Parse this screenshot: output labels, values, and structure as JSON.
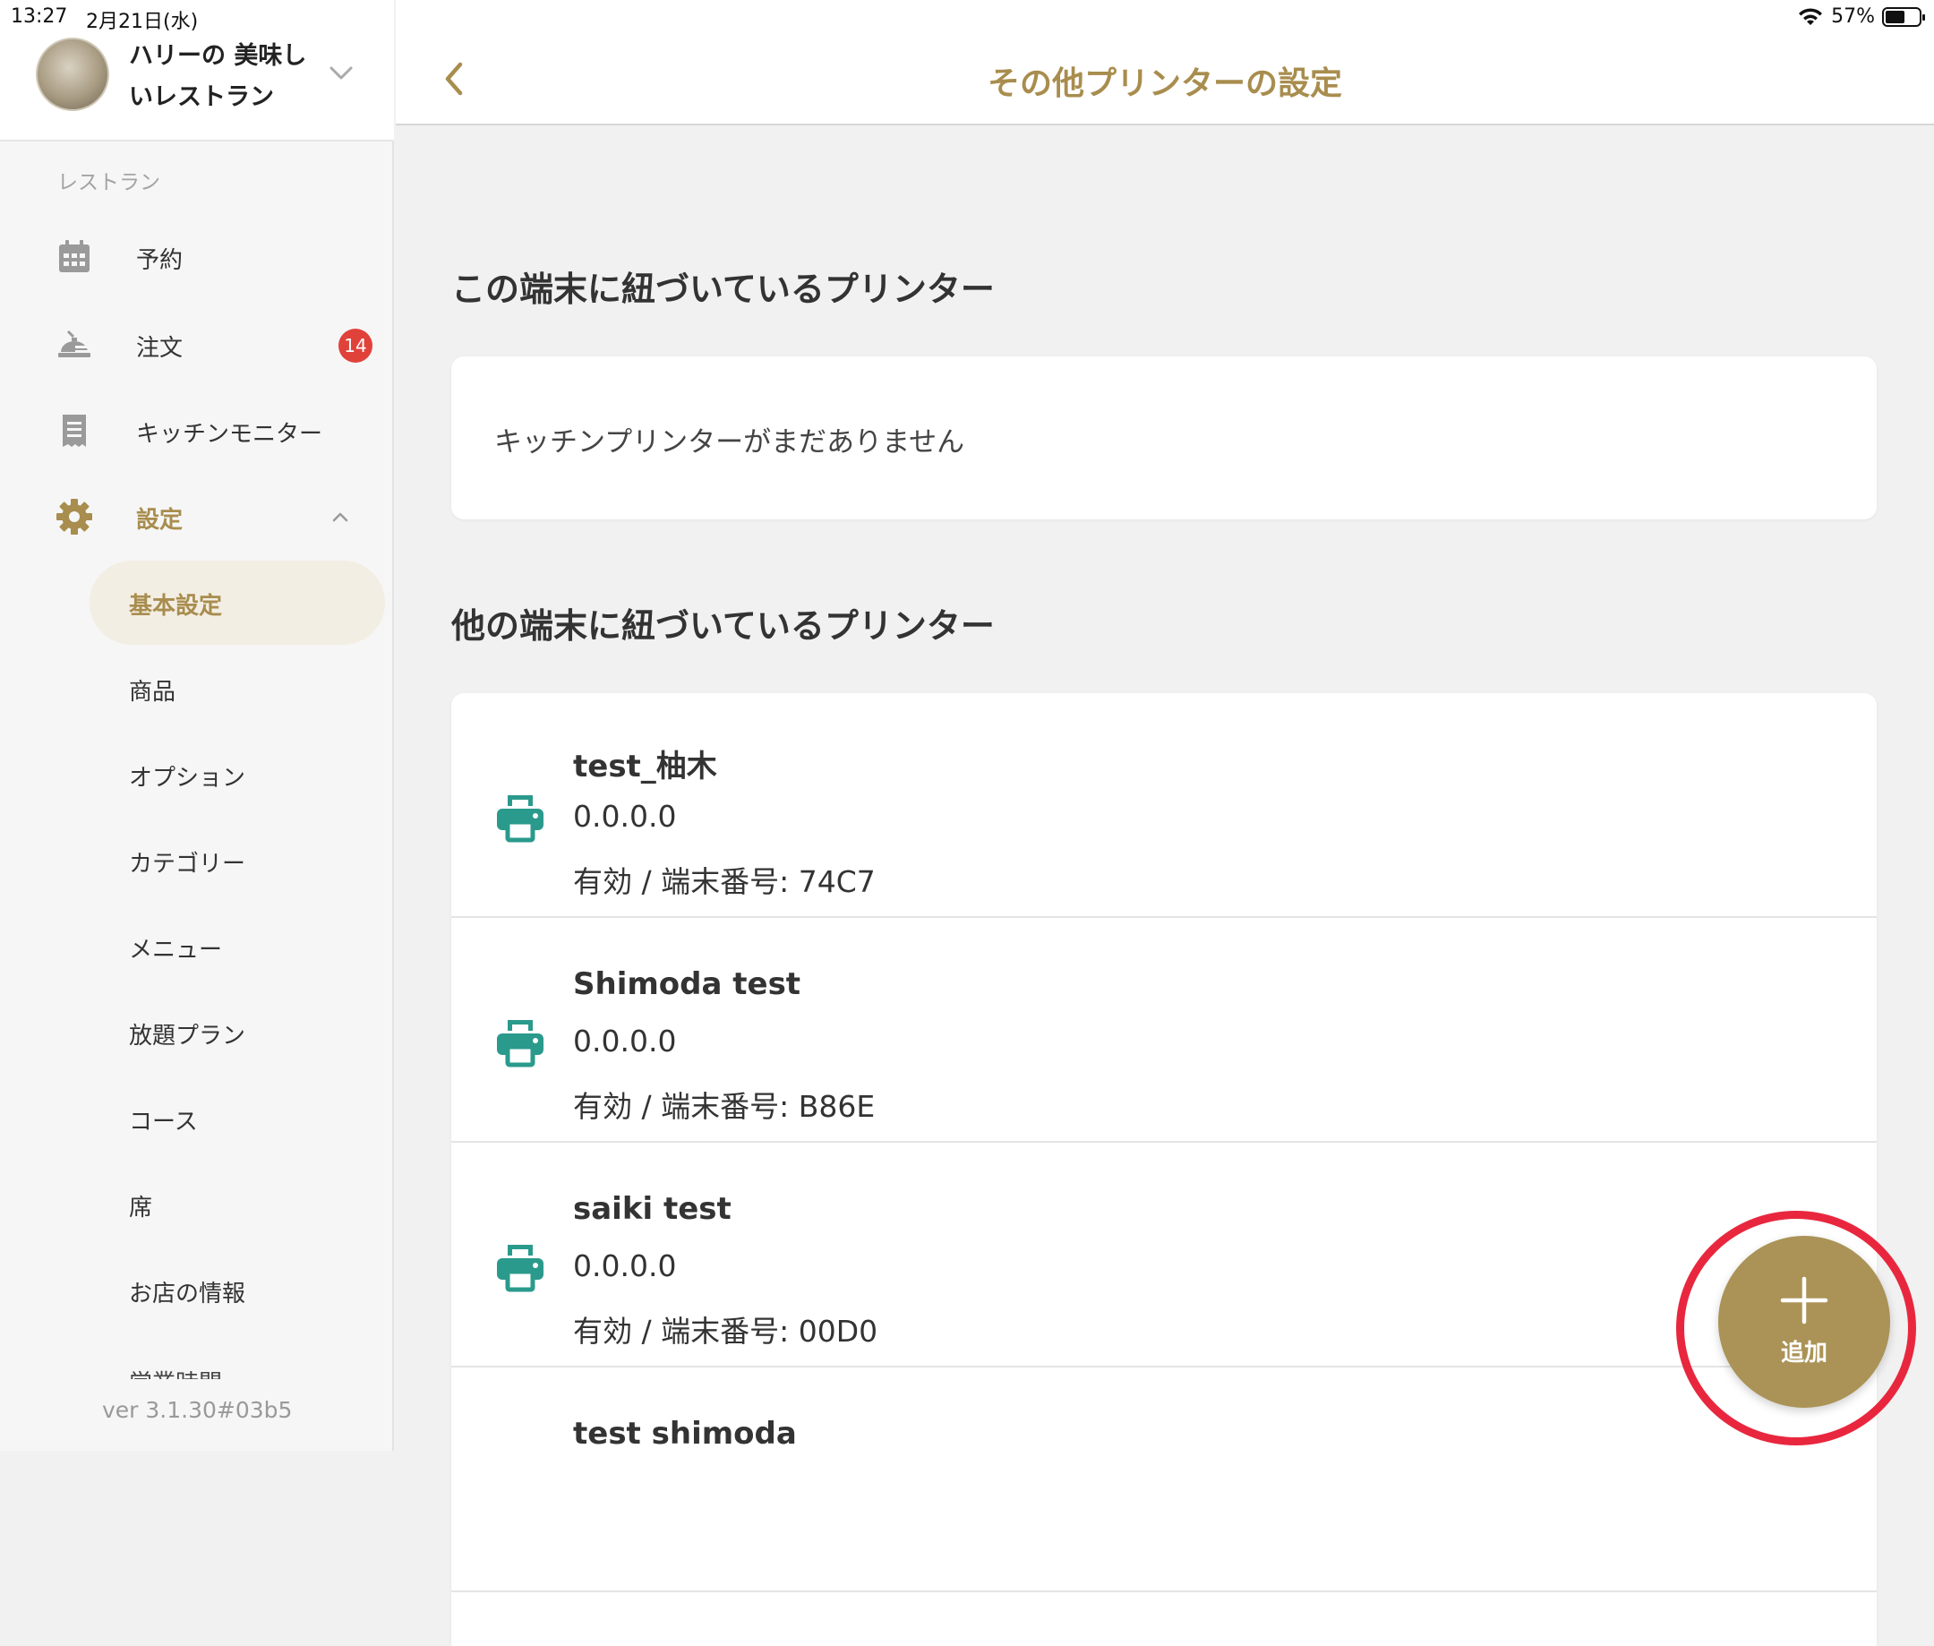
{
  "status_bar": {
    "time": "13:27",
    "date": "2月21日(水)",
    "battery": "57%",
    "battery_level": 0.57
  },
  "sidebar": {
    "store_name": "ハリーの 美味しいレストラン",
    "section_label": "レストラン",
    "nav_items": [
      {
        "label": "予約",
        "icon": "calendar-icon"
      },
      {
        "label": "注文",
        "icon": "order-icon",
        "badge": "14"
      },
      {
        "label": "キッチンモニター",
        "icon": "receipt-icon"
      },
      {
        "label": "設定",
        "icon": "gear-icon",
        "expanded": true
      }
    ],
    "settings_sub_items": [
      {
        "label": "基本設定",
        "active": true
      },
      {
        "label": "商品"
      },
      {
        "label": "オプション"
      },
      {
        "label": "カテゴリー"
      },
      {
        "label": "メニュー"
      },
      {
        "label": "放題プラン"
      },
      {
        "label": "コース"
      },
      {
        "label": "席"
      },
      {
        "label": "お店の情報"
      },
      {
        "label": "営業時間"
      }
    ],
    "version": "ver 3.1.30#03b5"
  },
  "header": {
    "title": "その他プリンターの設定"
  },
  "main": {
    "this_device_title": "この端末に紐づいているプリンター",
    "this_device_empty": "キッチンプリンターがまだありません",
    "other_devices_title": "他の端末に紐づいているプリンター",
    "printers": [
      {
        "name": "test_柚木",
        "ip": "0.0.0.0",
        "status": "有効 / 端末番号: 74C7"
      },
      {
        "name": "Shimoda test",
        "ip": "0.0.0.0",
        "status": "有効 / 端末番号: B86E"
      },
      {
        "name": "saiki test",
        "ip": "0.0.0.0",
        "status": "有効 / 端末番号: 00D0"
      },
      {
        "name": "test shimoda",
        "ip": "",
        "status": ""
      }
    ]
  },
  "fab": {
    "label": "追加"
  },
  "colors": {
    "accent": "#a88d4e",
    "printer_icon": "#2a9a8c",
    "badge": "#e0423a",
    "highlight": "#e8273e"
  }
}
